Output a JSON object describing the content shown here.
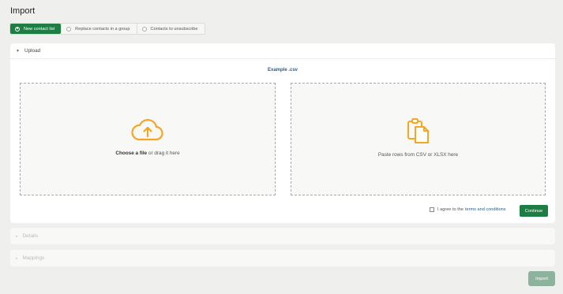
{
  "page": {
    "title": "Import"
  },
  "tabs": [
    {
      "label": "New contact list",
      "active": true
    },
    {
      "label": "Replace contacts in a group",
      "active": false
    },
    {
      "label": "Contacts to unsubscribe",
      "active": false
    }
  ],
  "upload": {
    "header": "Upload",
    "example_link": "Example .csv",
    "file_drop": {
      "bold": "Choose a file",
      "rest": " or drag it here",
      "icon": "cloud-upload-icon"
    },
    "paste_drop": {
      "text": "Paste rows from CSV or XLSX here",
      "icon": "clipboard-icon"
    },
    "agree_prefix": "I agree to the",
    "agree_link": "terms and conditions",
    "continue_label": "Continue"
  },
  "details": {
    "header": "Details"
  },
  "mappings": {
    "header": "Mappings"
  },
  "import_label": "Import",
  "colors": {
    "primary": "#1e7d43",
    "primary_disabled": "#8db39c",
    "accent_icon": "#f5a623",
    "link": "#2c5d8a"
  }
}
